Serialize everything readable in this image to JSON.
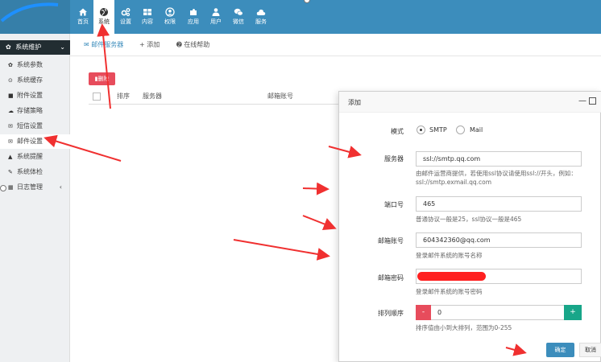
{
  "topnav": [
    {
      "label": "首页",
      "icon": "home-icon"
    },
    {
      "label": "系统",
      "icon": "globe-icon"
    },
    {
      "label": "设置",
      "icon": "cogs-icon"
    },
    {
      "label": "内容",
      "icon": "grid-icon"
    },
    {
      "label": "权限",
      "icon": "user-circle-icon"
    },
    {
      "label": "应用",
      "icon": "puzzle-icon"
    },
    {
      "label": "用户",
      "icon": "user-icon"
    },
    {
      "label": "微信",
      "icon": "wechat-icon"
    },
    {
      "label": "服务",
      "icon": "cloud-icon"
    }
  ],
  "sidebar": {
    "header": "系统维护",
    "items": [
      {
        "label": "系统参数",
        "icon": "gear-icon"
      },
      {
        "label": "系统缓存",
        "icon": "clock-icon"
      },
      {
        "label": "附件设置",
        "icon": "folder-icon"
      },
      {
        "label": "存储策略",
        "icon": "cloud-icon"
      },
      {
        "label": "短信设置",
        "icon": "envelope-icon"
      },
      {
        "label": "邮件设置",
        "icon": "envelope-open-icon"
      },
      {
        "label": "系统提醒",
        "icon": "bell-icon"
      },
      {
        "label": "系统体检",
        "icon": "wrench-icon"
      },
      {
        "label": "日志管理",
        "icon": "calendar-icon"
      }
    ]
  },
  "tabs": {
    "mail_server": "邮件服务器",
    "add": "+ 添加",
    "help": "在线帮助"
  },
  "table": {
    "delete_button": "删除",
    "columns": [
      "排序",
      "服务器",
      "邮箱账号"
    ]
  },
  "dialog": {
    "title": "添加",
    "mode_label": "模式",
    "mode_options": [
      "SMTP",
      "Mail"
    ],
    "mode_selected": "SMTP",
    "server_label": "服务器",
    "server_value": "ssl://smtp.qq.com",
    "server_help": "由邮件运营商提供，若使用ssl协议请使用ssl://开头，例如：ssl://smtp.exmail.qq.com",
    "port_label": "端口号",
    "port_value": "465",
    "port_help": "普通协议一般是25，ssl协议一般是465",
    "account_label": "邮箱账号",
    "account_value": "604342360@qq.com",
    "account_help": "登录邮件系统的账号名称",
    "password_label": "邮箱密码",
    "password_help": "登录邮件系统的账号密码",
    "order_label": "排列顺序",
    "order_value": "0",
    "order_minus": "-",
    "order_plus": "+",
    "order_help": "排序值由小到大排列，范围为0-255",
    "ok_button": "确定",
    "cancel_button": "取消"
  },
  "colors": {
    "topbar": "#3c8dbc",
    "sidebar_header": "#222d32",
    "danger": "#e74c5c",
    "success": "#18a689",
    "annotation_arrow": "#f03030"
  }
}
